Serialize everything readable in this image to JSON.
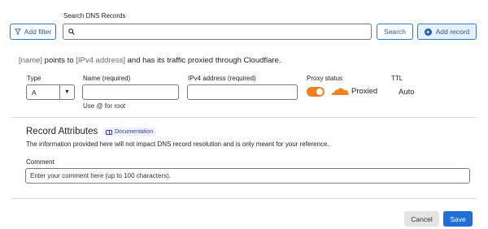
{
  "search": {
    "label": "Search DNS Records",
    "value": "",
    "filter_button": "Add filter",
    "search_button": "Search",
    "add_record_button": "Add record"
  },
  "summary": {
    "name_placeholder": "[name]",
    "points_to": " points to ",
    "ipv4_placeholder": "[IPv4 address]",
    "rest": " and has its traffic proxied through Cloudflare."
  },
  "record_form": {
    "type_label": "Type",
    "type_value": "A",
    "name_label": "Name (required)",
    "name_value": "",
    "name_hint": "Use @ for root",
    "ipv4_label": "IPv4 address (required)",
    "ipv4_value": "",
    "proxy_label": "Proxy status",
    "proxy_enabled": true,
    "proxy_text": "Proxied",
    "ttl_label": "TTL",
    "ttl_value": "Auto"
  },
  "attributes": {
    "title": "Record Attributes",
    "doc_badge": "Documentation",
    "description": "The information provided here will not impact DNS record resolution and is only meant for your reference.",
    "comment_label": "Comment",
    "comment_placeholder": "Enter your comment here (up to 100 characters)."
  },
  "footer": {
    "cancel": "Cancel",
    "save": "Save"
  },
  "colors": {
    "accent": "#1f6fd6",
    "proxy_orange": "#f38020"
  }
}
